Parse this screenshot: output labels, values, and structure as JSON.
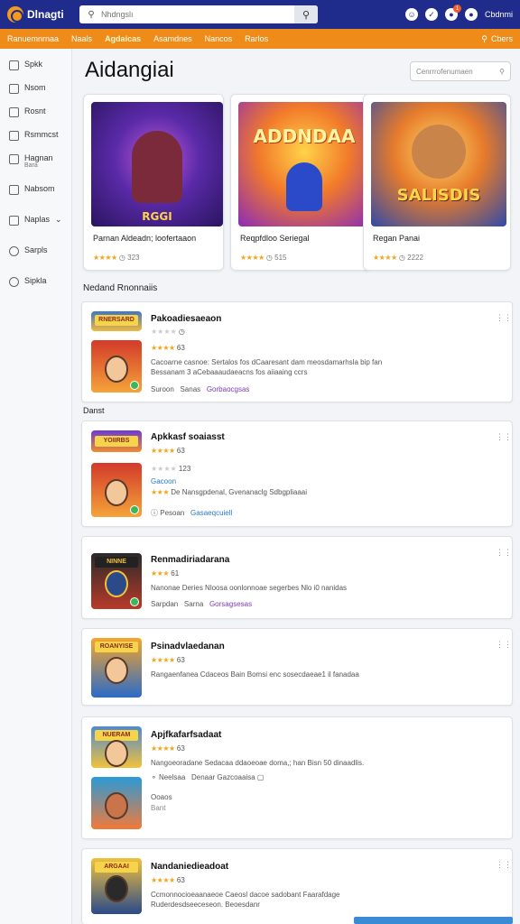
{
  "app": {
    "logo_text": "Dlnagti",
    "search_placeholder": "Nhdngslı",
    "icons": [
      "user-icon",
      "shield-icon",
      "bell-icon",
      "profile-icon"
    ],
    "notification_count": "1",
    "user_label": "Cbdnmi"
  },
  "nav": {
    "items": [
      "Ranuemnrnaa",
      "Naals",
      "Agdaicas",
      "Asamdnes",
      "Nancos",
      "Rarlos"
    ],
    "active_index": 2,
    "right_label": "Cbers"
  },
  "sidebar": {
    "items": [
      {
        "label": "Spkk",
        "sub": ""
      },
      {
        "label": "Nsom",
        "sub": ""
      },
      {
        "label": "Rosnt",
        "sub": ""
      },
      {
        "label": "Rsmmcst",
        "sub": ""
      },
      {
        "label": "Hagnan",
        "sub": "Bara"
      },
      {
        "label": "Nabsom",
        "sub": ""
      },
      {
        "label": "Naplas",
        "sub": ""
      },
      {
        "label": "Sarpls",
        "sub": ""
      },
      {
        "label": "Sipkla",
        "sub": ""
      }
    ]
  },
  "main": {
    "title": "Aidangiai",
    "search_placeholder": "Cenrrrofenumaen",
    "featured": [
      {
        "title": "Parnan Aldeadn; loofertaaon",
        "rating": "323",
        "art_label": "RGGI"
      },
      {
        "title": "Reqpfdloo Seriegal",
        "rating": "515",
        "art_label": "ADDNDAA"
      },
      {
        "title": "Regan Panai",
        "rating": "2222",
        "art_label": "SALISDIS"
      }
    ],
    "section_label": "Nedand Rnonnaiis",
    "group_label": "Danst",
    "list": [
      {
        "title": "Pakoadiesaeaon",
        "rating": "63",
        "desc": "Cacoarne casnoe: Sertalos fos dCaaresant dam meosdamarhsla bip fan",
        "desc2": "Bessanam 3 aCebaaaudaeacns fos aiiaaing ccrs",
        "meta_a": "Suroon",
        "meta_b": "Sanas",
        "link": "Gorbaocgsas",
        "thumb_label": "RNERSARD"
      },
      {
        "title": "Apkkasf soaiasst",
        "rating": "63",
        "rating2": "123",
        "desc": "Gacoon",
        "desc2": "De Nansgpdenal, Gvenanaclg Sdbgpliaaai",
        "meta_a": "Pesoan",
        "link": "Gasaeqcuiell",
        "thumb_label": "YOIIRBS"
      },
      {
        "title": "Renmadiriadarana",
        "rating": "61",
        "desc": "Nanonae Deries Nloosa oonlonnoae segerbes Nlo i0 nanidas",
        "meta_a": "Sarpdan",
        "meta_b": "Sarna",
        "link": "Gorsagsesas",
        "thumb_label": "NINNE"
      },
      {
        "title": "Psinadvlaedanan",
        "rating": "63",
        "desc": "Rangaenfanea Cdaceos Bain Bomsi enc sosecdaeae1 il fanadaa",
        "thumb_label": "ROANYISE"
      },
      {
        "title": "Apjfkafarfsadaat",
        "rating": "63",
        "desc": "Nangoeoradane Sedacaa ddaoeoae doma,; han Bisn 50 dinaadlis.",
        "meta_a": "Neelsaa",
        "meta_b": "Denaar Gazcoaaisa",
        "line3": "Ooaos",
        "line4": "Bant",
        "thumb_label": "NUERAM"
      },
      {
        "title": "Nandaniedieadoat",
        "rating": "63",
        "desc": "Ccmonnocioeaanaeoe Caeosl dacoe sadobant Faarafdage",
        "desc2": "Ruderdesdseeceseon. Beoesdanr",
        "thumb_label": "ARGAAI"
      }
    ]
  },
  "colors": {
    "topbar": "#1f2c8c",
    "nav": "#ef8b18",
    "accent_link": "#7b3bb8",
    "star": "#f2a51a"
  }
}
